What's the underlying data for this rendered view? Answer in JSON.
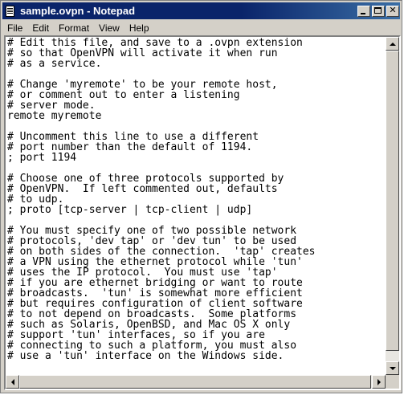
{
  "window": {
    "title": "sample.ovpn - Notepad",
    "buttons": {
      "minimize": "minimize",
      "maximize": "maximize",
      "close": "✕"
    }
  },
  "menu": [
    "File",
    "Edit",
    "Format",
    "View",
    "Help"
  ],
  "document": {
    "lines": [
      "# Edit this file, and save to a .ovpn extension",
      "# so that OpenVPN will activate it when run",
      "# as a service.",
      "",
      "# Change 'myremote' to be your remote host,",
      "# or comment out to enter a listening",
      "# server mode.",
      "remote myremote",
      "",
      "# Uncomment this line to use a different",
      "# port number than the default of 1194.",
      "; port 1194",
      "",
      "# Choose one of three protocols supported by",
      "# OpenVPN.  If left commented out, defaults",
      "# to udp.",
      "; proto [tcp-server | tcp-client | udp]",
      "",
      "# You must specify one of two possible network",
      "# protocols, 'dev tap' or 'dev tun' to be used",
      "# on both sides of the connection.  'tap' creates",
      "# a VPN using the ethernet protocol while 'tun'",
      "# uses the IP protocol.  You must use 'tap'",
      "# if you are ethernet bridging or want to route",
      "# broadcasts.  'tun' is somewhat more efficient",
      "# but requires configuration of client software",
      "# to not depend on broadcasts.  Some platforms",
      "# such as Solaris, OpenBSD, and Mac OS X only",
      "# support 'tun' interfaces, so if you are",
      "# connecting to such a platform, you must also",
      "# use a 'tun' interface on the Windows side."
    ]
  },
  "icons": [
    "notepad-icon",
    "minimize-icon",
    "maximize-icon",
    "close-icon",
    "scroll-up-icon",
    "scroll-down-icon",
    "scroll-left-icon",
    "scroll-right-icon"
  ]
}
